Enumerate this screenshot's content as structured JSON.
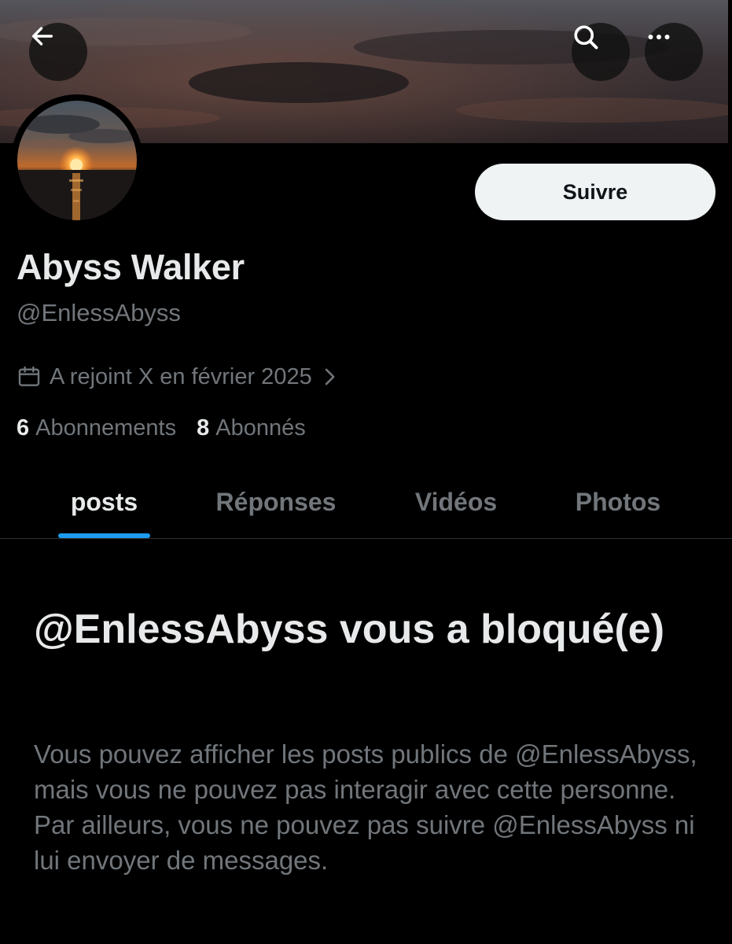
{
  "header": {
    "back_icon": "arrow-left-icon",
    "search_icon": "search-icon",
    "more_icon": "more-horizontal-icon"
  },
  "profile": {
    "display_name": "Abyss Walker",
    "handle": "@EnlessAbyss",
    "follow_label": "Suivre",
    "joined_text": "A rejoint X en février 2025",
    "joined_icon": "calendar-icon",
    "following_count": "6",
    "following_label": "Abonnements",
    "followers_count": "8",
    "followers_label": "Abonnés"
  },
  "tabs": [
    {
      "label": "posts",
      "active": true
    },
    {
      "label": "Réponses",
      "active": false
    },
    {
      "label": "Vidéos",
      "active": false
    },
    {
      "label": "Photos",
      "active": false
    }
  ],
  "blocked": {
    "title": "@EnlessAbyss vous a bloqué(e)",
    "body": "Vous pouvez afficher les posts publics de @EnlessAbyss, mais vous ne pouvez pas interagir avec cette personne. Par ailleurs, vous ne pouvez pas suivre @EnlessAbyss ni lui envoyer de messages."
  },
  "colors": {
    "background": "#000000",
    "accent": "#1d9bf0",
    "text_primary": "#e7e9ea",
    "text_secondary": "#71767b",
    "follow_button_bg": "#eff3f4"
  }
}
